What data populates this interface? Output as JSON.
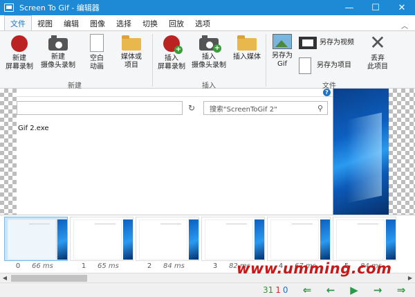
{
  "window": {
    "title": "Screen To Gif - 编辑器",
    "minimize_glyph": "—",
    "maximize_glyph": "☐",
    "close_glyph": "✕"
  },
  "tabs": [
    "文件",
    "视图",
    "编辑",
    "图像",
    "选择",
    "切换",
    "回放",
    "选项"
  ],
  "ribbon": {
    "collapse_glyph": "︿",
    "new_group": {
      "label": "新建",
      "buttons": [
        {
          "label": "新建\n屏幕录制",
          "icon": "record-icon"
        },
        {
          "label": "新建\n摄像头录制",
          "icon": "camera-icon"
        },
        {
          "label": "空白\n动画",
          "icon": "blank-page-icon"
        },
        {
          "label": "媒体或\n项目",
          "icon": "folder-icon"
        }
      ]
    },
    "insert_group": {
      "label": "插入",
      "buttons": [
        {
          "label": "插入\n屏幕录制",
          "icon": "record-add-icon"
        },
        {
          "label": "插入\n摄像头录制",
          "icon": "camera-add-icon"
        },
        {
          "label": "插入媒体",
          "icon": "folder-icon"
        }
      ]
    },
    "file_group": {
      "label": "文件",
      "buttons": [
        {
          "label": "另存为\nGif",
          "icon": "image-icon"
        },
        {
          "label": "另存为视频",
          "icon": "film-icon"
        },
        {
          "label": "另存为项目",
          "icon": "document-icon"
        },
        {
          "label": "丢弃\n此项目",
          "icon": "discard-icon"
        }
      ]
    }
  },
  "preview": {
    "help_glyph": "?",
    "refresh_glyph": "↻",
    "search_placeholder": "搜索\"ScreenToGif 2\"",
    "search_glyph": "⚲",
    "filename": "Gif 2.exe"
  },
  "frames": [
    {
      "index": "0",
      "duration": "66 ms",
      "selected": true
    },
    {
      "index": "1",
      "duration": "65 ms",
      "selected": false
    },
    {
      "index": "2",
      "duration": "84 ms",
      "selected": false
    },
    {
      "index": "3",
      "duration": "82 ms",
      "selected": false
    },
    {
      "index": "4",
      "duration": "67 ms",
      "selected": false
    },
    {
      "index": "5",
      "duration": "84 ms",
      "selected": false
    }
  ],
  "scrollbar": {
    "left_glyph": "◀",
    "right_glyph": "▶"
  },
  "status": {
    "total_frames": "31",
    "selected_frames": "1",
    "current_frame": "0",
    "nav": {
      "first": "⇐",
      "prev": "←",
      "play": "▶",
      "next": "→",
      "last": "⇒"
    }
  },
  "watermark": "www.umming.com",
  "colors": {
    "titlebar": "#1e8ad6",
    "accent": "#1e74c0",
    "record": "#b22222",
    "nav": "#2a9a4a",
    "watermark": "#c61a1a"
  }
}
